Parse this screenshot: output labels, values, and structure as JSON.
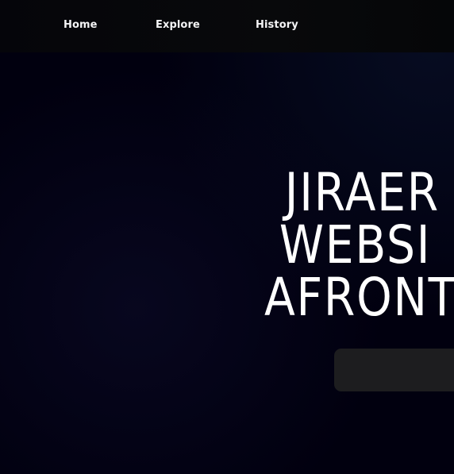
{
  "nav": {
    "links": [
      {
        "label": "Home"
      },
      {
        "label": "Explore"
      },
      {
        "label": "History"
      }
    ]
  },
  "hero": {
    "title_lines": [
      "JIRAER",
      "WEBSI",
      "AFRONT"
    ],
    "button_label": ""
  },
  "colors": {
    "background": "#01000f",
    "navbar": "#07080a",
    "text": "#ffffff",
    "button": "#1d1d1f"
  }
}
